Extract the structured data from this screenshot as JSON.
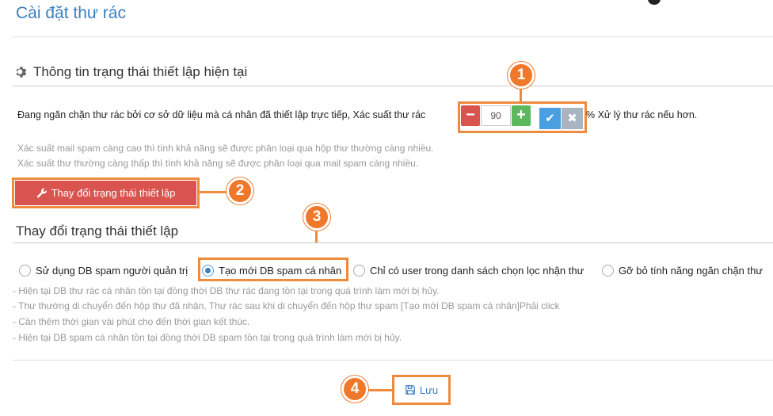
{
  "page": {
    "title": "Cài đặt thư rác"
  },
  "status_section": {
    "title": "Thông tin trạng thái thiết lập hiện tại",
    "status_text": "Đang ngăn chặn thư rác bởi cơ sở dữ liệu mà cá nhân đã thiết lập trực tiếp, Xác suất thư rác",
    "after_text": "% Xử lý thư rác nếu hơn.",
    "probability_value": "90",
    "minus_label": "−",
    "plus_label": "+",
    "confirm_icon": "check-icon",
    "cancel_icon": "x-icon",
    "hint1": "Xác suất mail spam càng cao thì tính khả năng sẽ được phân loại qua hộp thư thường càng nhiều.",
    "hint2": "Xác suất thư thường càng thấp thì tính khả năng sẽ được phân loại qua mail spam càng nhiều.",
    "change_button": "Thay đổi trạng thái thiết lập"
  },
  "change_section": {
    "title": "Thay đổi trạng thái thiết lập",
    "options": [
      {
        "label": "Sử dụng DB spam người quản trị",
        "checked": false
      },
      {
        "label": "Tạo mới DB spam cá nhân",
        "checked": true
      },
      {
        "label": "Chỉ có user trong danh sách chọn lọc nhận thư",
        "checked": false
      },
      {
        "label": "Gỡ bỏ tính năng ngăn chặn thư",
        "checked": false
      }
    ],
    "notes": [
      "- Hiện tại DB thư rác cá nhân tồn tại đồng thời DB thư rác đang tồn tại trong quá trình làm mới bị hủy.",
      "- Thư thường di chuyển đến hộp thư đã nhận, Thư rác sau khi di chuyển đến hộp thư spam [Tạo mới DB spam cá nhân]Phải click",
      "- Cần thêm thời gian vài phút cho đến thời gian kết thúc.",
      "- Hiện tại DB spam cá nhân tồn tại đồng thời DB spam tồn tại trong quá trình làm mới bị hủy."
    ],
    "save_button": "Lưu"
  },
  "callouts": [
    "1",
    "2",
    "3",
    "4"
  ],
  "colors": {
    "accent": "#3a7fc1",
    "danger": "#d9534f",
    "success": "#5cb85c",
    "callout": "#f0782a"
  }
}
